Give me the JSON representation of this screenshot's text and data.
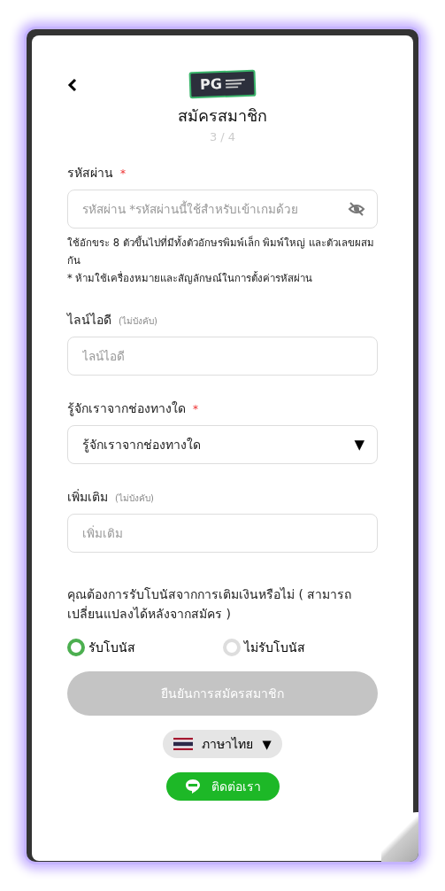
{
  "header": {
    "logo_text": "PG",
    "title": "สมัครสมาชิก",
    "step": "3 / 4"
  },
  "fields": [
    {
      "kind": "password",
      "label": "รหัสผ่าน",
      "required": true,
      "placeholder": "รหัสผ่าน *รหัสผ่านนี้ใช้สำหรับเข้าเกมด้วย",
      "hints": [
        "ใช้อักขระ 8 ตัวขึ้นไปที่มีทั้งตัวอักษรพิมพ์เล็ก พิมพ์ใหญ่ และตัวเลขผสมกัน",
        "* ห้ามใช้เครื่องหมายและสัญลักษณ์ในการตั้งค่ารหัสผ่าน"
      ]
    },
    {
      "kind": "text",
      "label": "ไลน์ไอดี",
      "required": false,
      "optional_note": "(ไม่บังคับ)",
      "placeholder": "ไลน์ไอดี"
    },
    {
      "kind": "select",
      "label": "รู้จักเราจากช่องทางใด",
      "required": true,
      "value": "รู้จักเราจากช่องทางใด",
      "caret": "▼"
    },
    {
      "kind": "text",
      "label": "เพิ่มเติม",
      "required": false,
      "optional_note": "(ไม่บังคับ)",
      "placeholder": "เพิ่มเติม"
    }
  ],
  "required_mark": "*",
  "bonus": {
    "question": "คุณต้องการรับโบนัสจากการเติมเงินหรือไม่ ( สามารถเปลี่ยนแปลงได้หลังจากสมัคร )",
    "options": [
      {
        "label": "รับโบนัส",
        "selected": true
      },
      {
        "label": "ไม่รับโบนัส",
        "selected": false
      }
    ]
  },
  "submit": {
    "label": "ยืนยันการสมัครสมาชิก",
    "disabled": true
  },
  "language": {
    "label": "ภาษาไทย",
    "caret": "▼"
  },
  "contact": {
    "label": "ติดต่อเรา"
  }
}
